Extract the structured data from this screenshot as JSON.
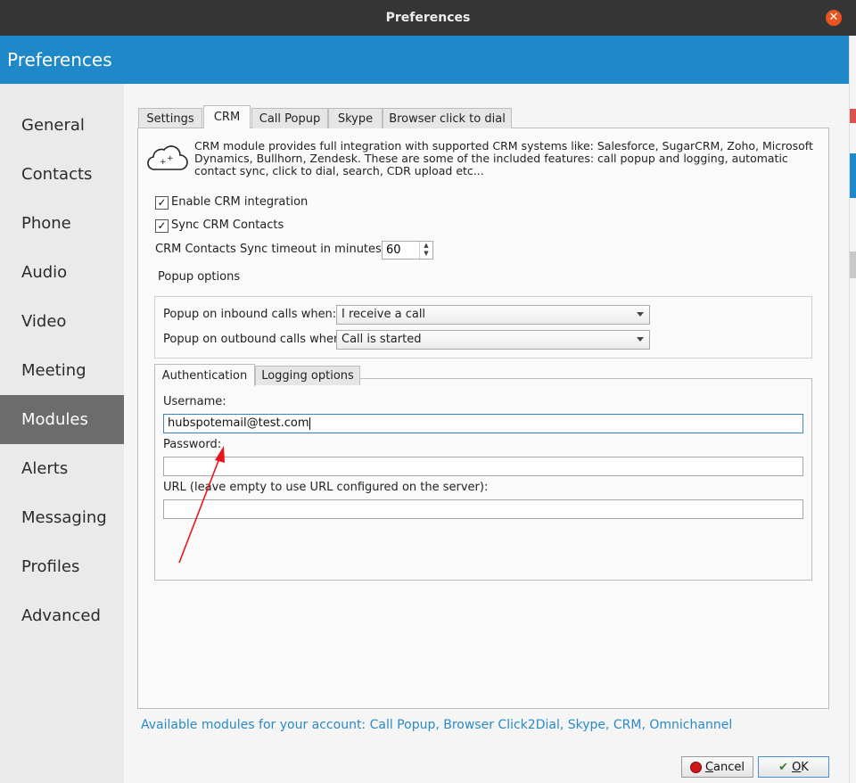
{
  "window": {
    "title": "Preferences",
    "close_icon": "close-icon"
  },
  "header": {
    "title": "Preferences",
    "color": "#1e88c9"
  },
  "sidebar": {
    "items": [
      {
        "label": "General"
      },
      {
        "label": "Contacts"
      },
      {
        "label": "Phone"
      },
      {
        "label": "Audio"
      },
      {
        "label": "Video"
      },
      {
        "label": "Meeting"
      },
      {
        "label": "Modules",
        "active": true
      },
      {
        "label": "Alerts"
      },
      {
        "label": "Messaging"
      },
      {
        "label": "Profiles"
      },
      {
        "label": "Advanced"
      }
    ]
  },
  "tabs": [
    {
      "label": "Settings"
    },
    {
      "label": "CRM",
      "active": true
    },
    {
      "label": "Call Popup"
    },
    {
      "label": "Skype"
    },
    {
      "label": "Browser click to dial"
    }
  ],
  "crm": {
    "description": "CRM module provides full integration with supported CRM systems like: Salesforce, SugarCRM, Zoho, Microsoft Dynamics, Bullhorn, Zendesk. These are some of the included features: call popup and logging, automatic contact sync, click to dial, search, CDR upload etc...",
    "enable_label": "Enable CRM integration",
    "enable_checked": true,
    "sync_label": "Sync CRM Contacts",
    "sync_checked": true,
    "timeout_label": "CRM Contacts Sync timeout in minutes",
    "timeout_value": "60",
    "popup_options_label": "Popup options",
    "inbound_label": "Popup on inbound calls when:",
    "inbound_value": "I receive a call",
    "outbound_label": "Popup on outbound calls when:",
    "outbound_value": "Call is started"
  },
  "subtabs": [
    {
      "label": "Authentication",
      "active": true
    },
    {
      "label": "Logging options"
    }
  ],
  "auth": {
    "username_label": "Username:",
    "username_value": "hubspotemail@test.com",
    "password_label": "Password:",
    "password_value": "",
    "url_label": "URL (leave empty to use URL configured on the server):",
    "url_value": ""
  },
  "footer": {
    "available_modules": "Available modules for your account: Call Popup, Browser Click2Dial, Skype, CRM, Omnichannel",
    "cancel_label": "Cancel",
    "ok_label": "OK"
  },
  "annotation": {
    "arrow_color": "#e8141b"
  }
}
